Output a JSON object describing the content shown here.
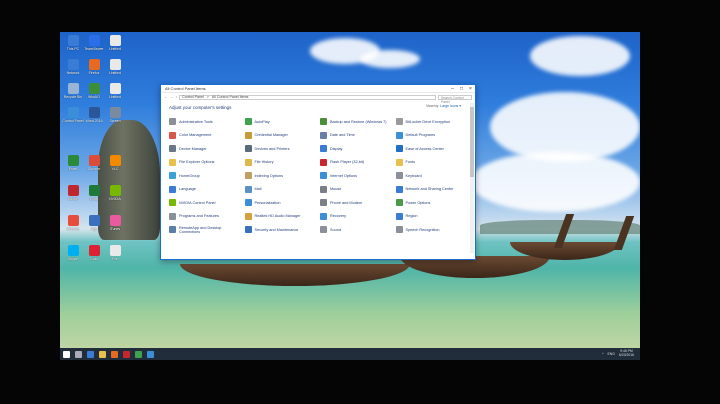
{
  "desktop_icons": [
    {
      "label": "This PC",
      "color": "#3a7bd5"
    },
    {
      "label": "TeamViewer",
      "color": "#2a6ee8"
    },
    {
      "label": "Untitled",
      "color": "#e9e9e9"
    },
    {
      "label": "Network",
      "color": "#3a7bd5"
    },
    {
      "label": "Firefox",
      "color": "#e66a1f"
    },
    {
      "label": "Untitled",
      "color": "#e9e9e9"
    },
    {
      "label": "Recycle Bin",
      "color": "#9ab4d6"
    },
    {
      "label": "WinAIO",
      "color": "#3b8f3b"
    },
    {
      "label": "Untitled",
      "color": "#e9e9e9"
    },
    {
      "label": "Control Panel",
      "color": "#3a8fd8"
    },
    {
      "label": "Word 2016",
      "color": "#2b579a"
    },
    {
      "label": "Screen",
      "color": "#7a8aa0"
    },
    {
      "label": "Excel",
      "color": "#2a8a3a"
    },
    {
      "label": "Chrome",
      "color": "#dd4b39"
    },
    {
      "label": "VLC",
      "color": "#f08a00"
    },
    {
      "label": "Adobe",
      "color": "#c0262d"
    },
    {
      "label": "Excel",
      "color": "#1f7a3a"
    },
    {
      "label": "NVIDIA",
      "color": "#76b900"
    },
    {
      "label": "Chrome",
      "color": "#e84c3d"
    },
    {
      "label": "App",
      "color": "#3a6fbf"
    },
    {
      "label": "iTunes",
      "color": "#e95aa0"
    },
    {
      "label": "Skype",
      "color": "#00aff0"
    },
    {
      "label": "Tools",
      "color": "#d23"
    },
    {
      "label": "File",
      "color": "#e9e9e9"
    }
  ],
  "window": {
    "title": "All Control Panel Items",
    "address_parts": [
      "Control Panel",
      ">",
      "All Control Panel Items"
    ],
    "search_placeholder": "Search Control Panel",
    "heading": "Adjust your computer's settings",
    "view_by_label": "View by:",
    "view_by_value": "Large icons ▾",
    "items": [
      {
        "label": "Administrative Tools",
        "color": "#8a8f99"
      },
      {
        "label": "AutoPlay",
        "color": "#3fa34d"
      },
      {
        "label": "Backup and Restore (Windows 7)",
        "color": "#4a8f3a"
      },
      {
        "label": "BitLocker Drive Encryption",
        "color": "#9a9a9a"
      },
      {
        "label": "Color Management",
        "color": "#d8574a"
      },
      {
        "label": "Credential Manager",
        "color": "#c69b3a"
      },
      {
        "label": "Date and Time",
        "color": "#6a7fa8"
      },
      {
        "label": "Default Programs",
        "color": "#3a8fd8"
      },
      {
        "label": "Device Manager",
        "color": "#6a7888"
      },
      {
        "label": "Devices and Printers",
        "color": "#5a6a7a"
      },
      {
        "label": "Display",
        "color": "#3a7bd5"
      },
      {
        "label": "Ease of Access Center",
        "color": "#1f6fc7"
      },
      {
        "label": "File Explorer Options",
        "color": "#e8c14a"
      },
      {
        "label": "File History",
        "color": "#e0b84a"
      },
      {
        "label": "Flash Player (32-bit)",
        "color": "#c8262e"
      },
      {
        "label": "Fonts",
        "color": "#e8c14a"
      },
      {
        "label": "HomeGroup",
        "color": "#3aa0d8"
      },
      {
        "label": "Indexing Options",
        "color": "#c0a060"
      },
      {
        "label": "Internet Options",
        "color": "#3a8fd8"
      },
      {
        "label": "Keyboard",
        "color": "#8a8f99"
      },
      {
        "label": "Language",
        "color": "#3a7bd5"
      },
      {
        "label": "Mail",
        "color": "#5a8fc8"
      },
      {
        "label": "Mouse",
        "color": "#7a7f88"
      },
      {
        "label": "Network and Sharing Center",
        "color": "#3a7bd5"
      },
      {
        "label": "NVIDIA Control Panel",
        "color": "#76b900"
      },
      {
        "label": "Personalization",
        "color": "#3a8fd8"
      },
      {
        "label": "Phone and Modem",
        "color": "#7a7f88"
      },
      {
        "label": "Power Options",
        "color": "#4a9a4a"
      },
      {
        "label": "Programs and Features",
        "color": "#8a8f99"
      },
      {
        "label": "Realtek HD Audio Manager",
        "color": "#d8a03a"
      },
      {
        "label": "Recovery",
        "color": "#3a8fd8"
      },
      {
        "label": "Region",
        "color": "#3a7bd5"
      },
      {
        "label": "RemoteApp and Desktop Connections",
        "color": "#5a7fa8"
      },
      {
        "label": "Security and Maintenance",
        "color": "#3a6fbf"
      },
      {
        "label": "Sound",
        "color": "#8a8f99"
      },
      {
        "label": "Speech Recognition",
        "color": "#8a8f99"
      }
    ]
  },
  "taskbar": {
    "icons": [
      "#ffffff",
      "#aab",
      "#3a7bd5",
      "#e8c14a",
      "#e66a1f",
      "#c8262e",
      "#3fa34d",
      "#3a8fd8"
    ],
    "lang": "ENG",
    "time": "9:46 PM",
    "date": "6/23/2016"
  }
}
